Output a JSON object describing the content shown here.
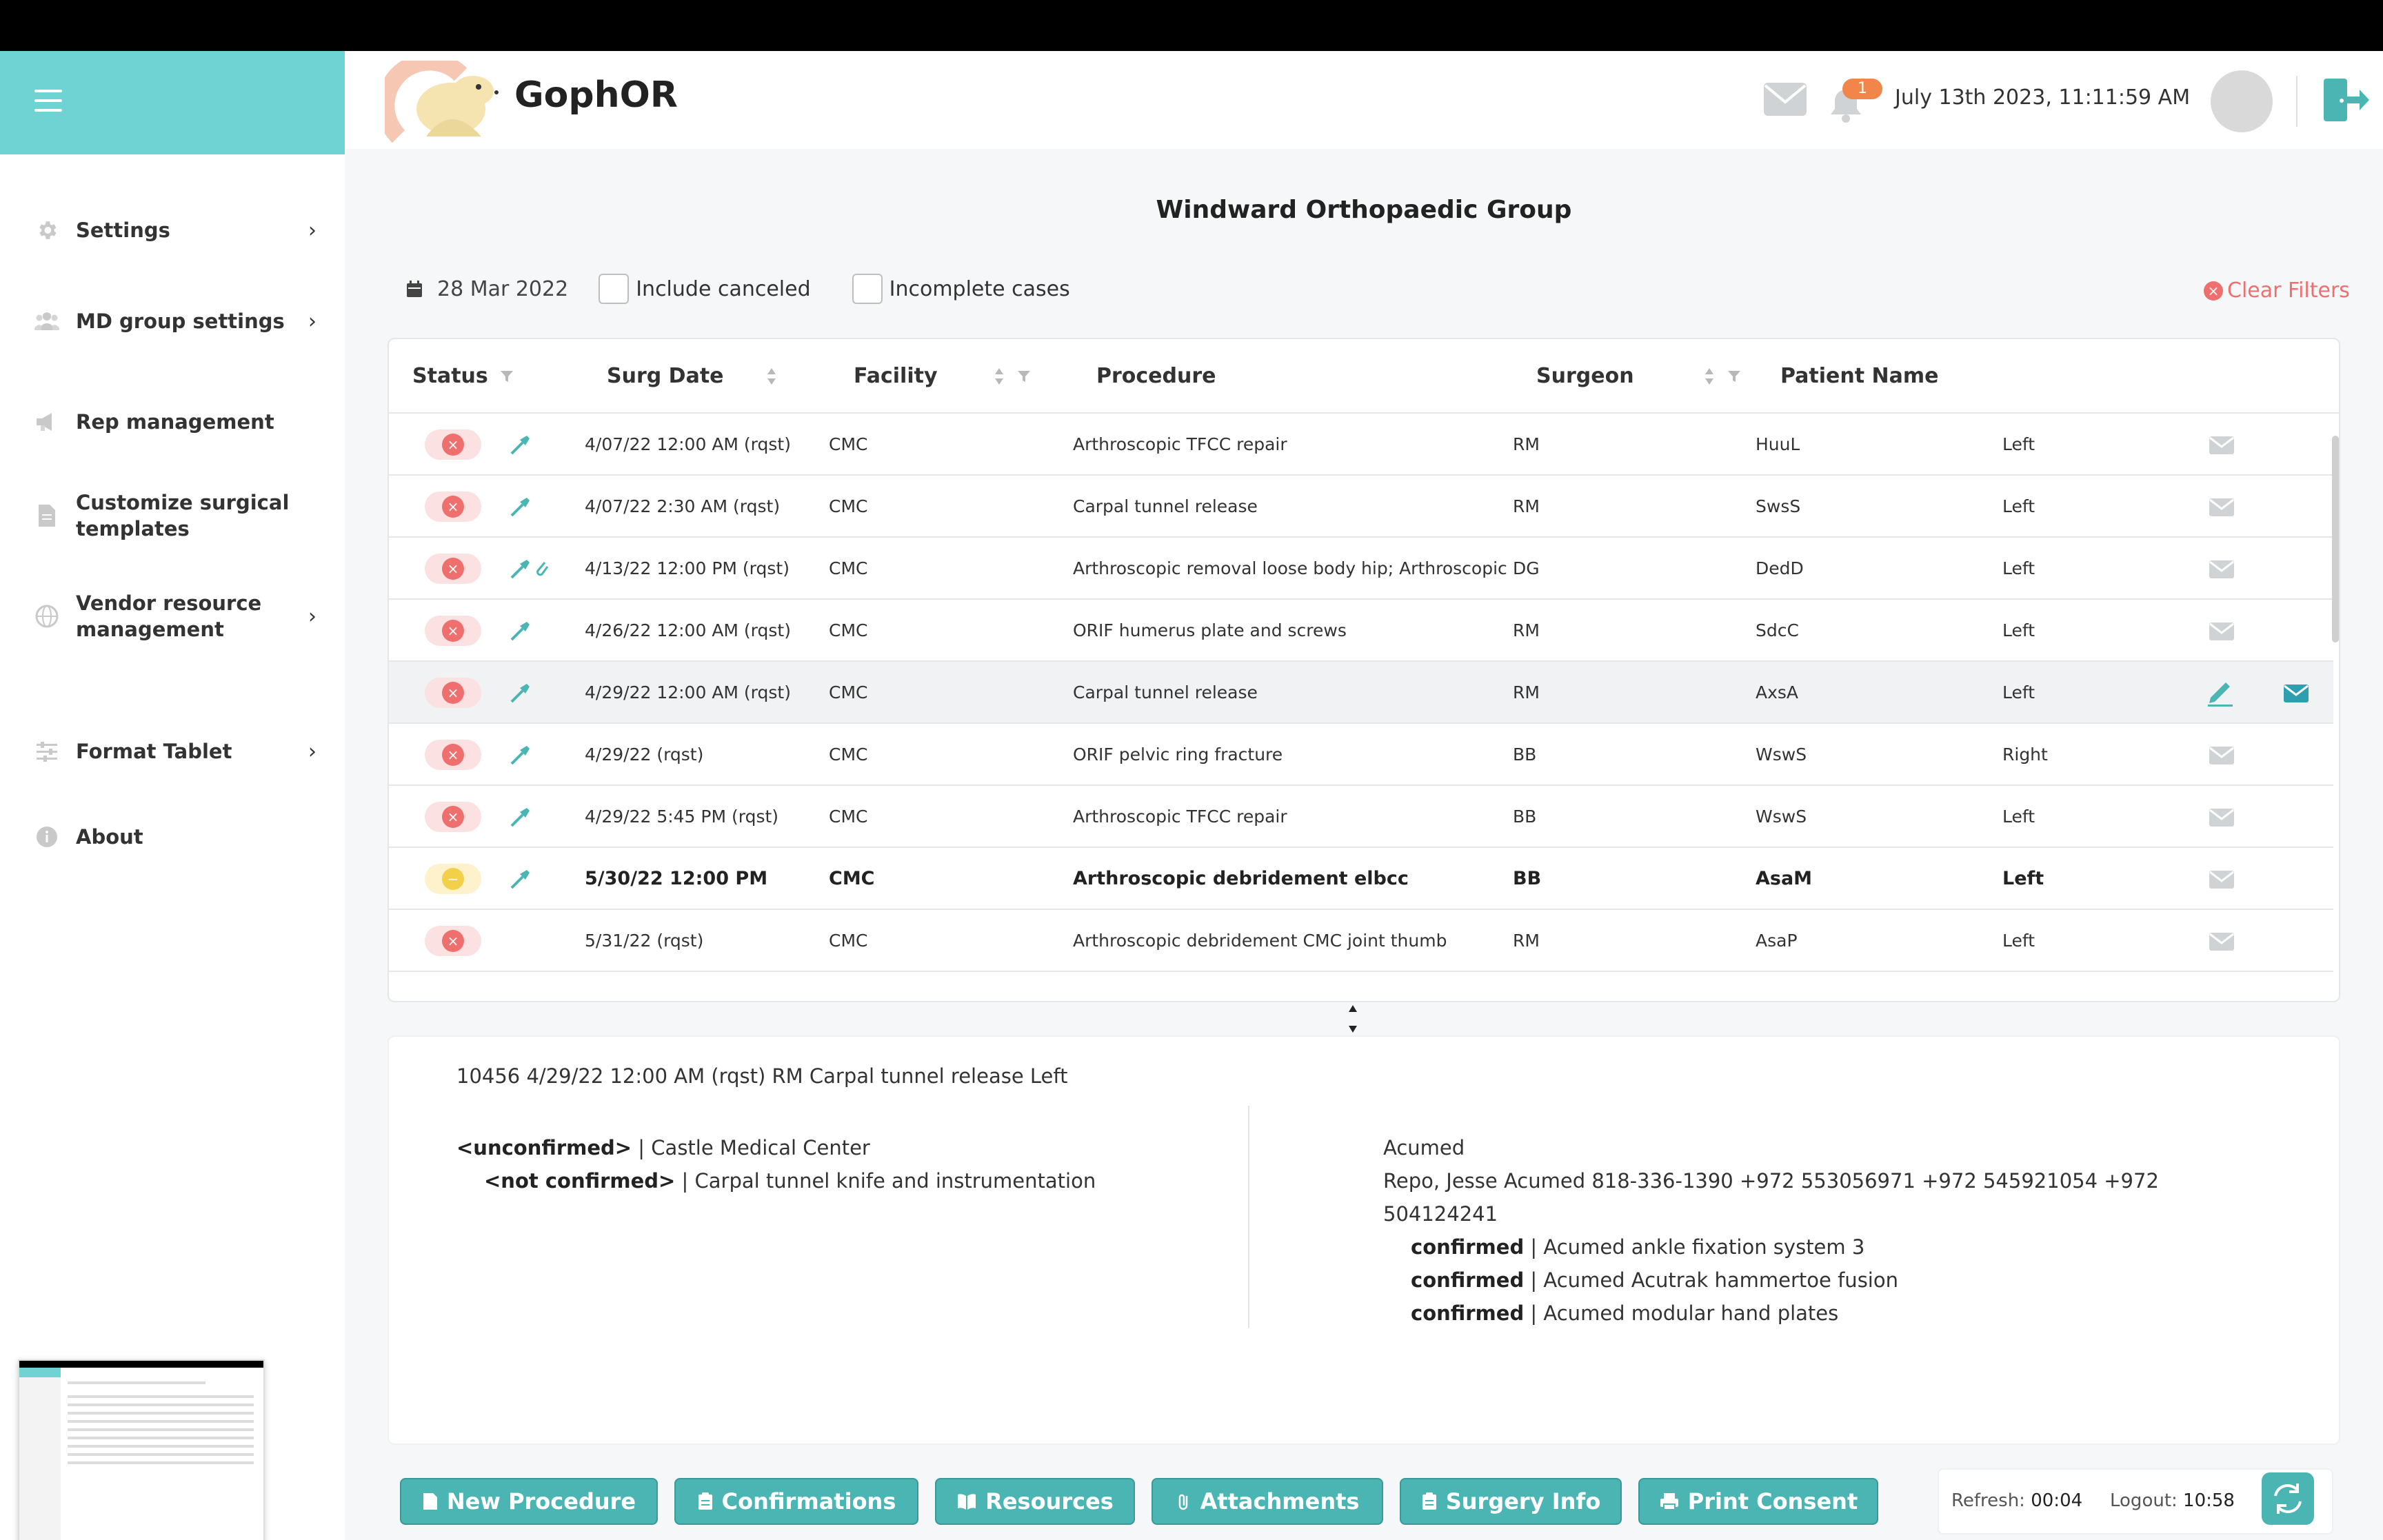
{
  "app": {
    "brand": "GophOR",
    "datetime": "July 13th 2023, 11:11:59 AM",
    "notification_count": "1"
  },
  "sidebar": {
    "items": [
      {
        "label": "Settings",
        "icon": "gear-icon",
        "chevron": true
      },
      {
        "label": "MD group settings",
        "icon": "users-icon",
        "chevron": true
      },
      {
        "label": "Rep management",
        "icon": "megaphone-icon",
        "chevron": false
      },
      {
        "label": "Customize surgical templates",
        "icon": "document-icon",
        "chevron": false
      },
      {
        "label": "Vendor resource management",
        "icon": "globe-icon",
        "chevron": true
      },
      {
        "label": "Format Tablet",
        "icon": "sliders-icon",
        "chevron": true
      },
      {
        "label": "About",
        "icon": "info-icon",
        "chevron": false
      }
    ]
  },
  "page": {
    "title": "Windward Orthopaedic Group"
  },
  "filters": {
    "date": "28 Mar 2022",
    "include_canceled": "Include canceled",
    "incomplete_cases": "Incomplete cases",
    "clear": "Clear Filters"
  },
  "table": {
    "headers": {
      "status": "Status",
      "surg_date": "Surg Date",
      "facility": "Facility",
      "procedure": "Procedure",
      "surgeon": "Surgeon",
      "patient_name": "Patient Name"
    },
    "rows": [
      {
        "status": "canceled",
        "date": "4/07/22 12:00 AM (rqst)",
        "facility": "CMC",
        "procedure": "Arthroscopic TFCC repair",
        "surgeon": "RM",
        "patient": "HuuL",
        "side": "Left"
      },
      {
        "status": "canceled",
        "date": "4/07/22 2:30 AM (rqst)",
        "facility": "CMC",
        "procedure": "Carpal tunnel release",
        "surgeon": "RM",
        "patient": "SwsS",
        "side": "Left"
      },
      {
        "status": "canceled",
        "date": "4/13/22 12:00 PM (rqst)",
        "facility": "CMC",
        "procedure": "Arthroscopic removal loose body hip; Arthroscopic ...",
        "surgeon": "DG",
        "patient": "DedD",
        "side": "Left"
      },
      {
        "status": "canceled",
        "date": "4/26/22 12:00 AM (rqst)",
        "facility": "CMC",
        "procedure": "ORIF humerus plate and screws",
        "surgeon": "RM",
        "patient": "SdcC",
        "side": "Left"
      },
      {
        "status": "canceled",
        "date": "4/29/22 12:00 AM (rqst)",
        "facility": "CMC",
        "procedure": "Carpal tunnel release",
        "surgeon": "RM",
        "patient": "AxsA",
        "side": "Left"
      },
      {
        "status": "canceled",
        "date": "4/29/22 (rqst)",
        "facility": "CMC",
        "procedure": "ORIF pelvic ring fracture",
        "surgeon": "BB",
        "patient": "WswS",
        "side": "Right"
      },
      {
        "status": "canceled",
        "date": "4/29/22 5:45 PM (rqst)",
        "facility": "CMC",
        "procedure": "Arthroscopic TFCC repair",
        "surgeon": "BB",
        "patient": "WswS",
        "side": "Left"
      },
      {
        "status": "pending",
        "date": "5/30/22 12:00 PM",
        "facility": "CMC",
        "procedure": "Arthroscopic debridement elbcc",
        "surgeon": "BB",
        "patient": "AsaM",
        "side": "Left"
      },
      {
        "status": "canceled",
        "date": "5/31/22 (rqst)",
        "facility": "CMC",
        "procedure": "Arthroscopic debridement CMC joint thumb",
        "surgeon": "RM",
        "patient": "AsaP",
        "side": "Left"
      }
    ]
  },
  "details": {
    "heading": "10456 4/29/22 12:00 AM (rqst) RM Carpal tunnel release Left",
    "left": {
      "line1_status": "<unconfirmed>",
      "line1_text": " | Castle Medical Center",
      "line2_status": "<not confirmed>",
      "line2_text": " | Carpal tunnel knife and instrumentation"
    },
    "right": {
      "vendor": "Acumed",
      "contact_line1": "Repo, Jesse Acumed 818-336-1390 +972 553056971 +972 545921054 +972",
      "contact_line2": "504124241",
      "items": [
        {
          "status": "confirmed",
          "text": " | Acumed ankle fixation system 3"
        },
        {
          "status": "confirmed",
          "text": " | Acumed Acutrak hammertoe fusion"
        },
        {
          "status": "confirmed",
          "text": " | Acumed modular hand plates"
        }
      ]
    }
  },
  "footer": {
    "buttons": {
      "new_procedure": "New Procedure",
      "confirmations": "Confirmations",
      "resources": "Resources",
      "attachments": "Attachments",
      "surgery_info": "Surgery Info",
      "print_consent": "Print Consent"
    },
    "refresh_label": "Refresh:",
    "refresh_value": "00:04",
    "logout_label": "Logout:",
    "logout_value": "10:58"
  },
  "colors": {
    "accent": "#4bb5b3",
    "sidebar_header": "#6fd3d3",
    "canceled": "#ef6f6f",
    "pending": "#f2d04a",
    "badge": "#f2864a"
  }
}
